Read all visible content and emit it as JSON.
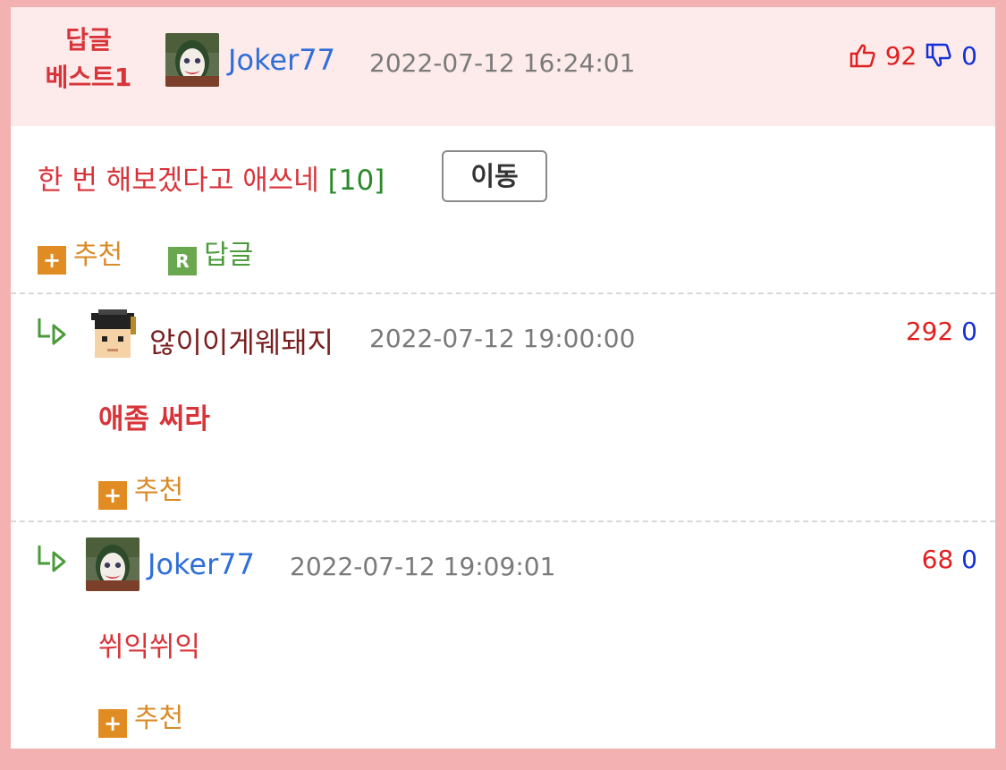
{
  "header": {
    "badge_line1": "답글",
    "badge_line2": "베스트1",
    "author": "Joker77",
    "date": "2022-07-12 16:24:01",
    "up": "92",
    "down": "0"
  },
  "main_comment": {
    "text": "한 번 해보겠다고 애쓰네",
    "reply_count": "[10]",
    "move_label": "이동",
    "recommend_label": "추천",
    "reply_label": "답글",
    "reply_icon_letter": "R",
    "plus_icon_symbol": "+"
  },
  "replies": [
    {
      "author": "않이이게웨돼지",
      "date": "2022-07-12 19:00:00",
      "up": "292",
      "down": "0",
      "text": "애좀 써라",
      "recommend_label": "추천"
    },
    {
      "author": "Joker77",
      "date": "2022-07-12 19:09:01",
      "up": "68",
      "down": "0",
      "text": "쒸익쒸익",
      "recommend_label": "추천"
    }
  ],
  "colors": {
    "page_border": "#f4b1b1",
    "header_bg": "#fdeaea",
    "badge": "#d8343a",
    "author_link": "#2f6fd8",
    "upvote": "#e02020",
    "downvote": "#1530d8",
    "recommend": "#d98b28",
    "reply": "#4a9a3a"
  },
  "icons": {
    "thumbs_up": "thumbs-up-icon",
    "thumbs_down": "thumbs-down-icon",
    "reply_arrow": "reply-arrow-icon",
    "plus": "plus-icon",
    "r_badge": "reply-r-icon"
  }
}
